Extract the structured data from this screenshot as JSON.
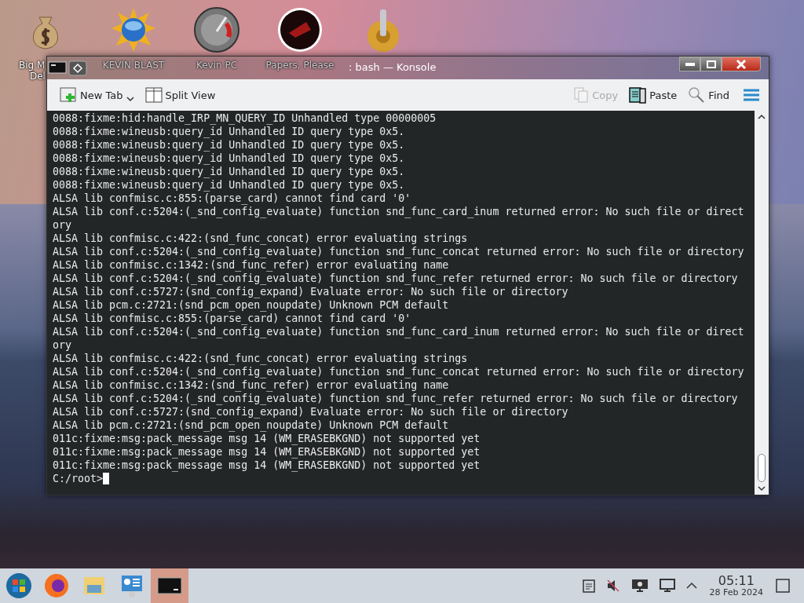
{
  "desktop_icons": [
    {
      "kind": "money",
      "label": "Big M",
      "label_2": "Del"
    },
    {
      "kind": "sun",
      "label": "KEVIN BLAST"
    },
    {
      "kind": "gauge",
      "label": "Kevin PC"
    },
    {
      "kind": "dark",
      "label": "Papers, Please"
    },
    {
      "kind": "gear"
    }
  ],
  "window": {
    "title": ": bash — Konsole"
  },
  "toolbar": {
    "left": [
      {
        "label": "New Tab",
        "kind": "newtab"
      },
      {
        "label": "Split View",
        "kind": "split"
      }
    ],
    "right": [
      {
        "label": "Copy",
        "kind": "copy",
        "disabled": true
      },
      {
        "label": "Paste",
        "kind": "paste",
        "disabled": false
      },
      {
        "label": "Find",
        "kind": "find",
        "disabled": false
      }
    ]
  },
  "terminal": {
    "lines": [
      "0088:fixme:hid:handle_IRP_MN_QUERY_ID Unhandled type 00000005",
      "0088:fixme:wineusb:query_id Unhandled ID query type 0x5.",
      "0088:fixme:wineusb:query_id Unhandled ID query type 0x5.",
      "0088:fixme:wineusb:query_id Unhandled ID query type 0x5.",
      "0088:fixme:wineusb:query_id Unhandled ID query type 0x5.",
      "0088:fixme:wineusb:query_id Unhandled ID query type 0x5.",
      "ALSA lib confmisc.c:855:(parse_card) cannot find card '0'",
      "ALSA lib conf.c:5204:(_snd_config_evaluate) function snd_func_card_inum returned error: No such file or direct",
      "ory",
      "ALSA lib confmisc.c:422:(snd_func_concat) error evaluating strings",
      "ALSA lib conf.c:5204:(_snd_config_evaluate) function snd_func_concat returned error: No such file or directory",
      "ALSA lib confmisc.c:1342:(snd_func_refer) error evaluating name",
      "ALSA lib conf.c:5204:(_snd_config_evaluate) function snd_func_refer returned error: No such file or directory",
      "ALSA lib conf.c:5727:(snd_config_expand) Evaluate error: No such file or directory",
      "ALSA lib pcm.c:2721:(snd_pcm_open_noupdate) Unknown PCM default",
      "ALSA lib confmisc.c:855:(parse_card) cannot find card '0'",
      "ALSA lib conf.c:5204:(_snd_config_evaluate) function snd_func_card_inum returned error: No such file or direct",
      "ory",
      "ALSA lib confmisc.c:422:(snd_func_concat) error evaluating strings",
      "ALSA lib conf.c:5204:(_snd_config_evaluate) function snd_func_concat returned error: No such file or directory",
      "ALSA lib confmisc.c:1342:(snd_func_refer) error evaluating name",
      "ALSA lib conf.c:5204:(_snd_config_evaluate) function snd_func_refer returned error: No such file or directory",
      "ALSA lib conf.c:5727:(snd_config_expand) Evaluate error: No such file or directory",
      "ALSA lib pcm.c:2721:(snd_pcm_open_noupdate) Unknown PCM default",
      "011c:fixme:msg:pack_message msg 14 (WM_ERASEBKGND) not supported yet",
      "011c:fixme:msg:pack_message msg 14 (WM_ERASEBKGND) not supported yet",
      "011c:fixme:msg:pack_message msg 14 (WM_ERASEBKGND) not supported yet"
    ],
    "prompt": "C:/root>"
  },
  "taskbar": {
    "apps": [
      {
        "kind": "start",
        "selected": false
      },
      {
        "kind": "browser",
        "selected": false
      },
      {
        "kind": "folder",
        "selected": false
      },
      {
        "kind": "monitor",
        "selected": false
      },
      {
        "kind": "terminal",
        "selected": true
      }
    ],
    "tray": [
      {
        "kind": "clipboard"
      },
      {
        "kind": "muted"
      },
      {
        "kind": "display"
      },
      {
        "kind": "screen"
      },
      {
        "kind": "expand"
      }
    ],
    "clock": {
      "time": "05:11",
      "date": "28 Feb 2024"
    }
  }
}
